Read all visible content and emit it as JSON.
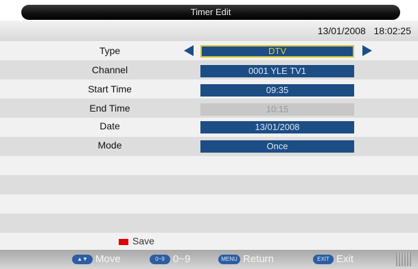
{
  "title": "Timer Edit",
  "datetime": "13/01/2008   18:02:25",
  "fields": [
    {
      "label": "Type",
      "value": "DTV"
    },
    {
      "label": "Channel",
      "value": "0001 YLE TV1"
    },
    {
      "label": "Start Time",
      "value": "09:35"
    },
    {
      "label": "End Time",
      "value": "10:15"
    },
    {
      "label": "Date",
      "value": "13/01/2008"
    },
    {
      "label": "Mode",
      "value": "Once"
    }
  ],
  "save_hint": {
    "label": "Save",
    "color": "#e00000"
  },
  "footer": {
    "move": {
      "key": "▲▼",
      "label": "Move"
    },
    "digits": {
      "key": "0~9",
      "label": "0~9"
    },
    "return": {
      "key": "MENU",
      "label": "Return"
    },
    "exit": {
      "key": "EXIT",
      "label": "Exit"
    }
  },
  "colors": {
    "field_bg": "#1c4d85",
    "focus_border": "#d8c22a",
    "disabled_bg": "#c7c7c7",
    "keycap": "#2b5ea2"
  }
}
